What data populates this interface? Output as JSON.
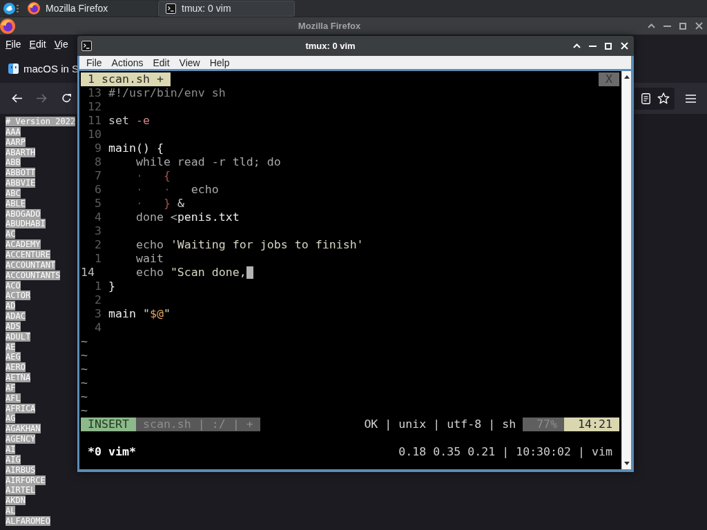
{
  "taskbar": {
    "tasks": [
      {
        "kind": "browser",
        "label": "Mozilla Firefox",
        "selected": false
      },
      {
        "kind": "terminal",
        "label": "tmux: 0 vim",
        "selected": true
      }
    ]
  },
  "firefox": {
    "title": "Mozilla Firefox",
    "active": false,
    "menu": [
      "File",
      "Edit",
      "Vie"
    ],
    "tab": {
      "label": "macOS in S"
    },
    "nav_buttons": [
      {
        "kind": "back",
        "disabled": false
      },
      {
        "kind": "forward",
        "disabled": true
      },
      {
        "kind": "reload",
        "disabled": false
      }
    ],
    "page": {
      "selected": true,
      "lines": [
        "# Version 2022",
        "AAA",
        "AARP",
        "ABARTH",
        "ABB",
        "ABBOTT",
        "ABBVIE",
        "ABC",
        "ABLE",
        "ABOGADO",
        "ABUDHABI",
        "AC",
        "ACADEMY",
        "ACCENTURE",
        "ACCOUNTANT",
        "ACCOUNTANTS",
        "ACO",
        "ACTOR",
        "AD",
        "ADAC",
        "ADS",
        "ADULT",
        "AE",
        "AEG",
        "AERO",
        "AETNA",
        "AF",
        "AFL",
        "AFRICA",
        "AG",
        "AGAKHAN",
        "AGENCY",
        "AI",
        "AIG",
        "AIRBUS",
        "AIRFORCE",
        "AIRTEL",
        "AKDN",
        "AL",
        "ALFAROMEO"
      ]
    }
  },
  "terminal": {
    "title": "tmux: 0 vim",
    "active": true,
    "menu": [
      "File",
      "Actions",
      "Edit",
      "View",
      "Help"
    ],
    "vim": {
      "tabs": [
        {
          "label": "1 scan.sh +",
          "selected": true
        }
      ],
      "close_label": "X",
      "lines": [
        {
          "number": "13",
          "current": false,
          "segments": [
            {
              "kind": "comment",
              "text": "#!/usr/bin/env sh"
            }
          ]
        },
        {
          "number": "12",
          "current": false
        },
        {
          "number": "11",
          "current": false,
          "segments": [
            {
              "kind": "plain",
              "text": "set"
            },
            {
              "kind": "flag",
              "text": " -e"
            }
          ]
        },
        {
          "number": "10",
          "current": false
        },
        {
          "number": "9",
          "current": false,
          "segments": [
            {
              "kind": "bright",
              "text": "main() {"
            }
          ]
        },
        {
          "number": "8",
          "current": false,
          "segments": [
            {
              "kind": "keyword",
              "text": "    while read -r tld; do"
            }
          ]
        },
        {
          "number": "7",
          "current": false,
          "segments": [
            {
              "kind": "listchar",
              "text": "    ·"
            },
            {
              "kind": "brace",
              "text": "   {"
            }
          ]
        },
        {
          "number": "6",
          "current": false,
          "segments": [
            {
              "kind": "listchar",
              "text": "    ·   ·"
            },
            {
              "kind": "keyword",
              "text": "   echo"
            }
          ]
        },
        {
          "number": "5",
          "current": false,
          "segments": [
            {
              "kind": "listchar",
              "text": "    ·"
            },
            {
              "kind": "brace",
              "text": "   }"
            },
            {
              "kind": "plain",
              "text": " &"
            }
          ]
        },
        {
          "number": "4",
          "current": false,
          "segments": [
            {
              "kind": "keyword",
              "text": "    done <"
            },
            {
              "kind": "bright",
              "text": "penis.txt"
            }
          ]
        },
        {
          "number": "3",
          "current": false
        },
        {
          "number": "2",
          "current": false,
          "segments": [
            {
              "kind": "keyword",
              "text": "    echo"
            },
            {
              "kind": "string",
              "text": " 'Waiting for jobs to finish'"
            }
          ]
        },
        {
          "number": "1",
          "current": false,
          "segments": [
            {
              "kind": "keyword",
              "text": "    wait"
            }
          ]
        },
        {
          "number": "14",
          "current": true,
          "segments": [
            {
              "kind": "keyword",
              "text": "    echo"
            },
            {
              "kind": "string",
              "text": " \"Scan done,"
            }
          ]
        },
        {
          "number": "1",
          "current": false,
          "segments": [
            {
              "kind": "bright",
              "text": "}"
            }
          ]
        },
        {
          "number": "2",
          "current": false
        },
        {
          "number": "3",
          "current": false,
          "segments": [
            {
              "kind": "bright",
              "text": "main"
            },
            {
              "kind": "string",
              "text": " \""
            },
            {
              "kind": "special",
              "text": "$@"
            },
            {
              "kind": "string",
              "text": "\""
            }
          ]
        },
        {
          "number": "4",
          "current": false
        }
      ],
      "filler": [
        "~",
        "~",
        "~",
        "~",
        "~",
        "~"
      ],
      "status": {
        "mode": "INSERT",
        "file_info": "scan.sh | :/ | +",
        "file_status": "OK | unix | utf-8 | sh",
        "percent": "77%",
        "position": "14:21"
      }
    },
    "tmux": {
      "window": "*0 vim*",
      "status": "0.18 0.35 0.21 | 10:30:02 | vim"
    }
  }
}
